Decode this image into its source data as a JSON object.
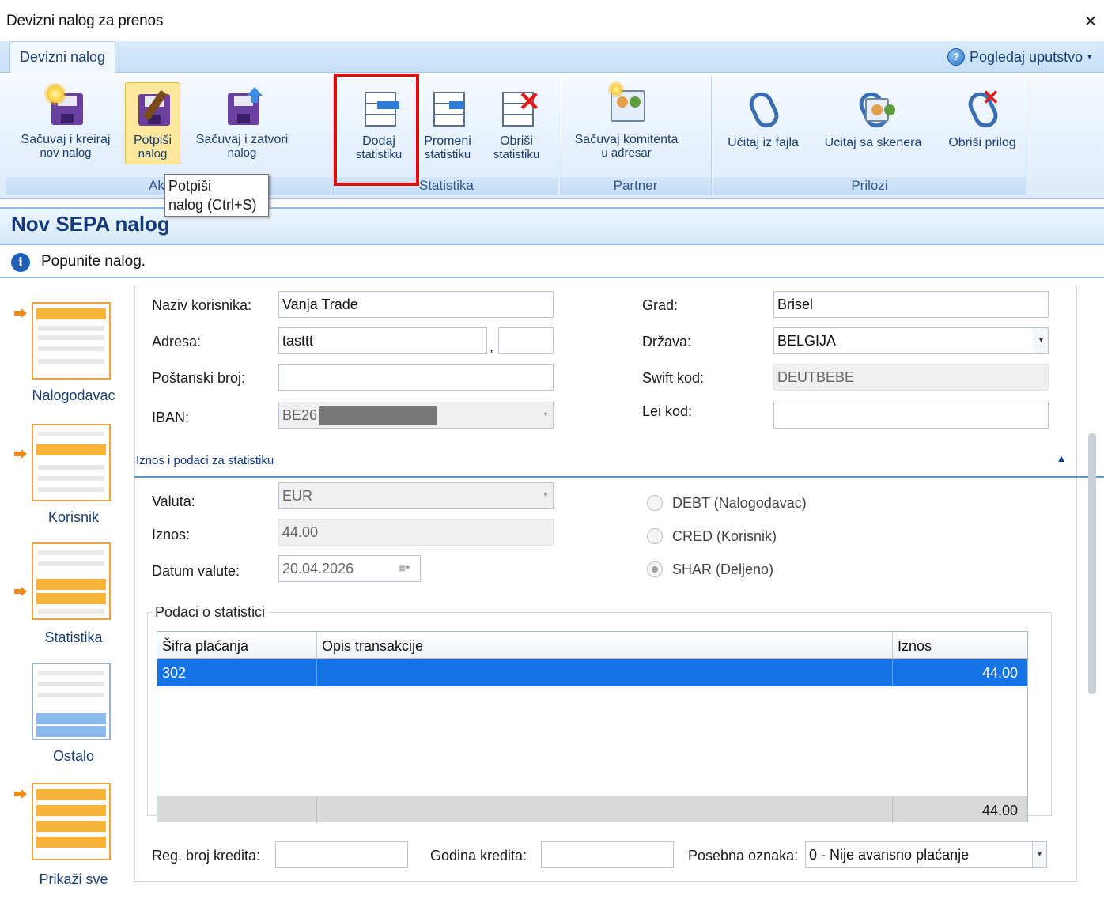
{
  "window": {
    "title": "Devizni nalog za prenos",
    "close": "×"
  },
  "ribbon": {
    "tab": "Devizni nalog",
    "help": "Pogledaj uputstvo",
    "buttons": {
      "save_new": {
        "line1": "Sačuvaj i kreiraj",
        "line2": "nov nalog"
      },
      "sign": {
        "line1": "Potpiši",
        "line2": "nalog"
      },
      "save_close": {
        "line1": "Sačuvaj i zatvori",
        "line2": "nalog"
      },
      "add_stat": {
        "line1": "Dodaj",
        "line2": "statistiku"
      },
      "edit_stat": {
        "line1": "Promeni",
        "line2": "statistiku"
      },
      "delete_stat": {
        "line1": "Obriši",
        "line2": "statistiku"
      },
      "save_partner": {
        "line1": "Sačuvaj komitenta",
        "line2": "u adresar"
      },
      "load_file": {
        "line1": "Učitaj iz fajla"
      },
      "load_scanner": {
        "line1": "Ucitaj sa skenera"
      },
      "delete_attachment": {
        "line1": "Obriši prilog"
      }
    },
    "groups": {
      "actions": "Ak",
      "statistics": "Statistika",
      "partner": "Partner",
      "attachments": "Prilozi"
    }
  },
  "tooltip": {
    "line1": "Potpiši",
    "line2": "nalog (Ctrl+S)"
  },
  "page": {
    "title": "Nov SEPA nalog",
    "info": "Popunite nalog."
  },
  "nav": [
    "Nalogodavac",
    "Korisnik",
    "Statistika",
    "Ostalo",
    "Prikaži sve"
  ],
  "form": {
    "labels": {
      "naziv": "Naziv korisnika:",
      "adresa": "Adresa:",
      "postanski": "Poštanski broj:",
      "iban": "IBAN:",
      "grad": "Grad:",
      "drzava": "Država:",
      "swift": "Swift kod:",
      "lei": "Lei kod:"
    },
    "values": {
      "naziv": "Vanja Trade",
      "adresa": "tasttt",
      "adresa_sep": ",",
      "postanski": "",
      "iban": "BE26",
      "grad": "Brisel",
      "drzava": "BELGIJA",
      "swift": "DEUTBEBE",
      "lei": ""
    }
  },
  "section": {
    "title": "Iznos i podaci za statistiku"
  },
  "amount": {
    "labels": {
      "valuta": "Valuta:",
      "iznos": "Iznos:",
      "datum": "Datum valute:"
    },
    "values": {
      "valuta": "EUR",
      "iznos": "44.00",
      "datum": "20.04.2026"
    },
    "radios": [
      {
        "label": "DEBT (Nalogodavac)",
        "checked": false
      },
      {
        "label": "CRED (Korisnik)",
        "checked": false
      },
      {
        "label": "SHAR (Deljeno)",
        "checked": true
      }
    ]
  },
  "stats": {
    "legend": "Podaci o statistici",
    "columns": [
      "Šifra plaćanja",
      "Opis transakcije",
      "Iznos"
    ],
    "rows": [
      {
        "sifra": "302",
        "opis": "",
        "iznos": "44.00"
      }
    ],
    "total": "44.00"
  },
  "bottom": {
    "labels": {
      "reg": "Reg. broj kredita:",
      "godina": "Godina kredita:",
      "posebna": "Posebna oznaka:"
    },
    "values": {
      "reg": "",
      "godina": "",
      "posebna": "0 - Nije avansno plaćanje"
    }
  }
}
